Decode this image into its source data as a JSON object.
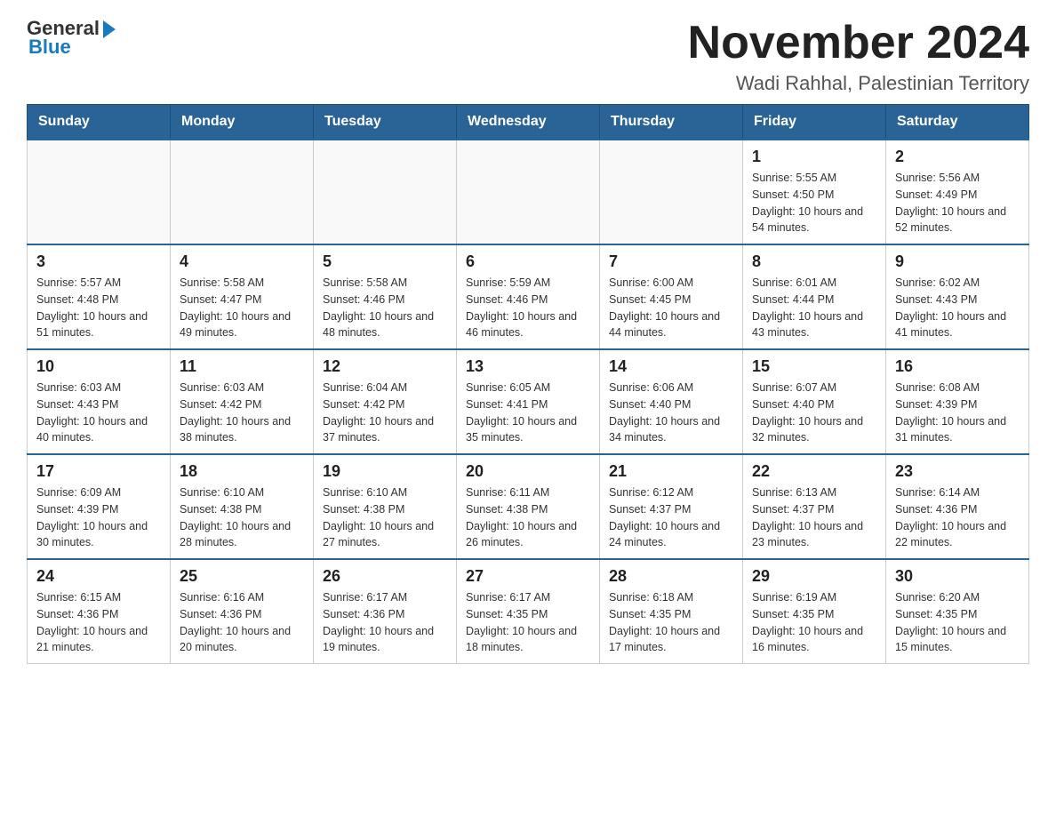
{
  "header": {
    "logo": {
      "general": "General",
      "blue": "Blue"
    },
    "title": "November 2024",
    "location": "Wadi Rahhal, Palestinian Territory"
  },
  "calendar": {
    "days_of_week": [
      "Sunday",
      "Monday",
      "Tuesday",
      "Wednesday",
      "Thursday",
      "Friday",
      "Saturday"
    ],
    "weeks": [
      [
        {
          "day": "",
          "info": ""
        },
        {
          "day": "",
          "info": ""
        },
        {
          "day": "",
          "info": ""
        },
        {
          "day": "",
          "info": ""
        },
        {
          "day": "",
          "info": ""
        },
        {
          "day": "1",
          "info": "Sunrise: 5:55 AM\nSunset: 4:50 PM\nDaylight: 10 hours and 54 minutes."
        },
        {
          "day": "2",
          "info": "Sunrise: 5:56 AM\nSunset: 4:49 PM\nDaylight: 10 hours and 52 minutes."
        }
      ],
      [
        {
          "day": "3",
          "info": "Sunrise: 5:57 AM\nSunset: 4:48 PM\nDaylight: 10 hours and 51 minutes."
        },
        {
          "day": "4",
          "info": "Sunrise: 5:58 AM\nSunset: 4:47 PM\nDaylight: 10 hours and 49 minutes."
        },
        {
          "day": "5",
          "info": "Sunrise: 5:58 AM\nSunset: 4:46 PM\nDaylight: 10 hours and 48 minutes."
        },
        {
          "day": "6",
          "info": "Sunrise: 5:59 AM\nSunset: 4:46 PM\nDaylight: 10 hours and 46 minutes."
        },
        {
          "day": "7",
          "info": "Sunrise: 6:00 AM\nSunset: 4:45 PM\nDaylight: 10 hours and 44 minutes."
        },
        {
          "day": "8",
          "info": "Sunrise: 6:01 AM\nSunset: 4:44 PM\nDaylight: 10 hours and 43 minutes."
        },
        {
          "day": "9",
          "info": "Sunrise: 6:02 AM\nSunset: 4:43 PM\nDaylight: 10 hours and 41 minutes."
        }
      ],
      [
        {
          "day": "10",
          "info": "Sunrise: 6:03 AM\nSunset: 4:43 PM\nDaylight: 10 hours and 40 minutes."
        },
        {
          "day": "11",
          "info": "Sunrise: 6:03 AM\nSunset: 4:42 PM\nDaylight: 10 hours and 38 minutes."
        },
        {
          "day": "12",
          "info": "Sunrise: 6:04 AM\nSunset: 4:42 PM\nDaylight: 10 hours and 37 minutes."
        },
        {
          "day": "13",
          "info": "Sunrise: 6:05 AM\nSunset: 4:41 PM\nDaylight: 10 hours and 35 minutes."
        },
        {
          "day": "14",
          "info": "Sunrise: 6:06 AM\nSunset: 4:40 PM\nDaylight: 10 hours and 34 minutes."
        },
        {
          "day": "15",
          "info": "Sunrise: 6:07 AM\nSunset: 4:40 PM\nDaylight: 10 hours and 32 minutes."
        },
        {
          "day": "16",
          "info": "Sunrise: 6:08 AM\nSunset: 4:39 PM\nDaylight: 10 hours and 31 minutes."
        }
      ],
      [
        {
          "day": "17",
          "info": "Sunrise: 6:09 AM\nSunset: 4:39 PM\nDaylight: 10 hours and 30 minutes."
        },
        {
          "day": "18",
          "info": "Sunrise: 6:10 AM\nSunset: 4:38 PM\nDaylight: 10 hours and 28 minutes."
        },
        {
          "day": "19",
          "info": "Sunrise: 6:10 AM\nSunset: 4:38 PM\nDaylight: 10 hours and 27 minutes."
        },
        {
          "day": "20",
          "info": "Sunrise: 6:11 AM\nSunset: 4:38 PM\nDaylight: 10 hours and 26 minutes."
        },
        {
          "day": "21",
          "info": "Sunrise: 6:12 AM\nSunset: 4:37 PM\nDaylight: 10 hours and 24 minutes."
        },
        {
          "day": "22",
          "info": "Sunrise: 6:13 AM\nSunset: 4:37 PM\nDaylight: 10 hours and 23 minutes."
        },
        {
          "day": "23",
          "info": "Sunrise: 6:14 AM\nSunset: 4:36 PM\nDaylight: 10 hours and 22 minutes."
        }
      ],
      [
        {
          "day": "24",
          "info": "Sunrise: 6:15 AM\nSunset: 4:36 PM\nDaylight: 10 hours and 21 minutes."
        },
        {
          "day": "25",
          "info": "Sunrise: 6:16 AM\nSunset: 4:36 PM\nDaylight: 10 hours and 20 minutes."
        },
        {
          "day": "26",
          "info": "Sunrise: 6:17 AM\nSunset: 4:36 PM\nDaylight: 10 hours and 19 minutes."
        },
        {
          "day": "27",
          "info": "Sunrise: 6:17 AM\nSunset: 4:35 PM\nDaylight: 10 hours and 18 minutes."
        },
        {
          "day": "28",
          "info": "Sunrise: 6:18 AM\nSunset: 4:35 PM\nDaylight: 10 hours and 17 minutes."
        },
        {
          "day": "29",
          "info": "Sunrise: 6:19 AM\nSunset: 4:35 PM\nDaylight: 10 hours and 16 minutes."
        },
        {
          "day": "30",
          "info": "Sunrise: 6:20 AM\nSunset: 4:35 PM\nDaylight: 10 hours and 15 minutes."
        }
      ]
    ]
  }
}
